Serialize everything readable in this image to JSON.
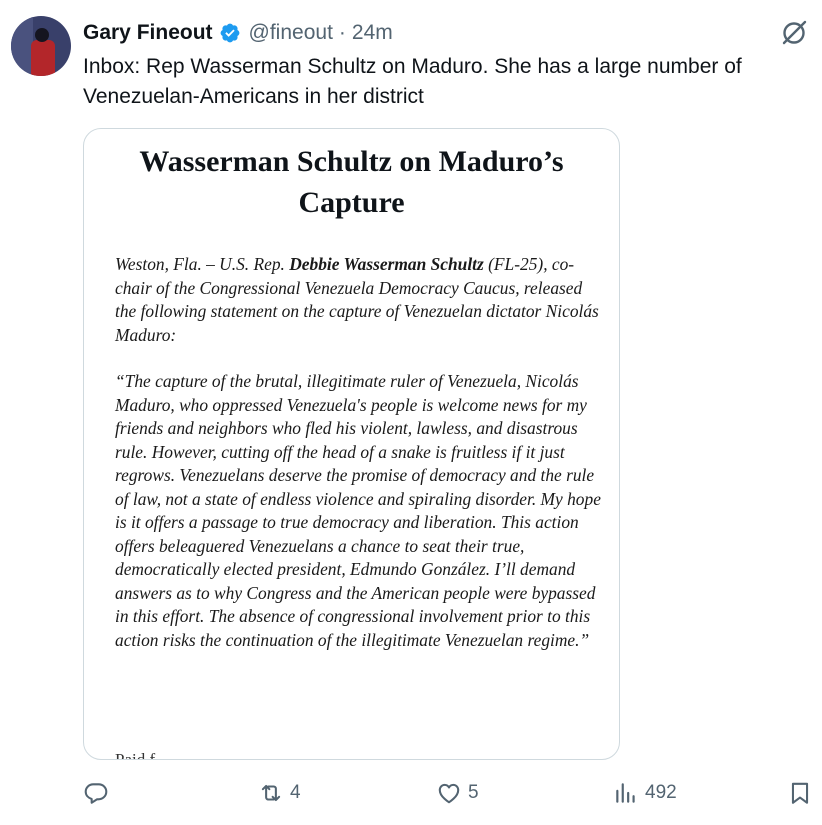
{
  "author": {
    "name": "Gary Fineout",
    "handle": "@fineout",
    "separator": "·",
    "time": "24m"
  },
  "icons": {
    "verified": "verified-badge-icon",
    "grok": "grok-icon",
    "reply": "reply-icon",
    "retweet": "retweet-icon",
    "like": "heart-icon",
    "views": "views-icon",
    "bookmark": "bookmark-icon"
  },
  "colors": {
    "verified": "#1d9bf0",
    "secondary_text": "#536471"
  },
  "tweet": {
    "text_line1": "Inbox: Rep Wasserman Schultz on Maduro. She has a large number of",
    "text_line2": "Venezuelan-Americans in her district"
  },
  "document": {
    "title_line1": "Wasserman Schultz on Maduro’s",
    "title_line2": "Capture",
    "intro_prefix": "Weston, Fla. – U.S. Rep. ",
    "rep_name": "Debbie Wasserman Schultz",
    "intro_suffix": " (FL-25), co-chair of the Congressional Venezuela Democracy Caucus, released the following statement on the capture of Venezuelan dictator Nicolás Maduro:",
    "quote": "“The capture of the brutal, illegitimate ruler of Venezuela, Nicolás Maduro, who oppressed Venezuela's people is welcome news for my friends and neighbors who fled his violent, lawless, and disastrous rule. However, cutting off the head of a snake is fruitless if it just regrows. Venezuelans deserve the promise of democracy and the rule of law, not a state of endless violence and spiraling disorder. My hope is it offers a passage to true democracy and liberation. This action offers beleaguered Venezuelans a chance to seat their true, democratically elected president, Edmundo González. I’ll demand answers as to why Congress and the American people were bypassed in this effort. The absence of congressional involvement prior to this action risks the continuation of the illegitimate Venezuelan regime.”",
    "cut_text": "Paid f..."
  },
  "stats": {
    "retweets": "4",
    "likes": "5",
    "views": "492"
  }
}
